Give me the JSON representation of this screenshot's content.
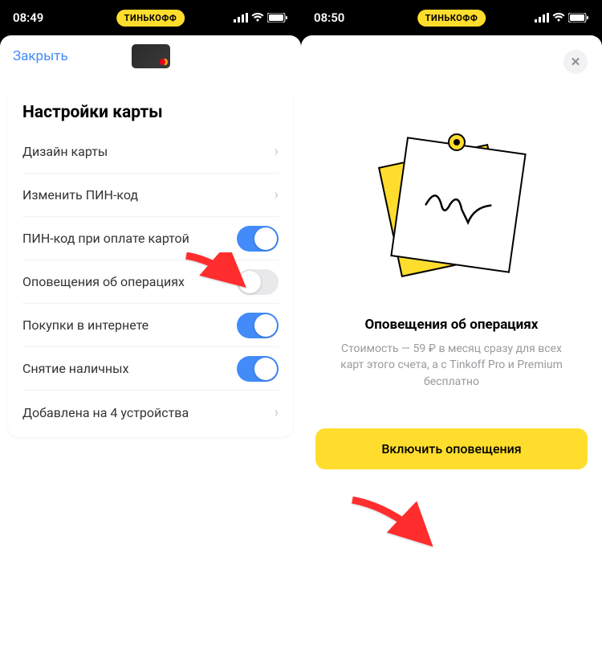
{
  "screen1": {
    "status": {
      "time": "08:49",
      "pill": "ТИНЬКОФФ"
    },
    "close": "Закрыть",
    "section_title": "Настройки карты",
    "rows": {
      "design": "Дизайн карты",
      "change_pin": "Изменить ПИН-код",
      "pin_on_pay": "ПИН-код при оплате картой",
      "notifications": "Оповещения об операциях",
      "online": "Покупки в интернете",
      "cash": "Снятие наличных",
      "devices": "Добавлена на 4 устройства"
    },
    "toggles": {
      "pin_on_pay": true,
      "notifications": false,
      "online": true,
      "cash": true
    }
  },
  "screen2": {
    "status": {
      "time": "08:50",
      "pill": "ТИНЬКОФФ"
    },
    "title": "Оповещения об операциях",
    "subtitle": "Стоимость — 59 ₽ в месяц сразу для всех карт этого счета, а с Tinkoff Pro и Premium бесплатно",
    "cta": "Включить оповещения"
  }
}
